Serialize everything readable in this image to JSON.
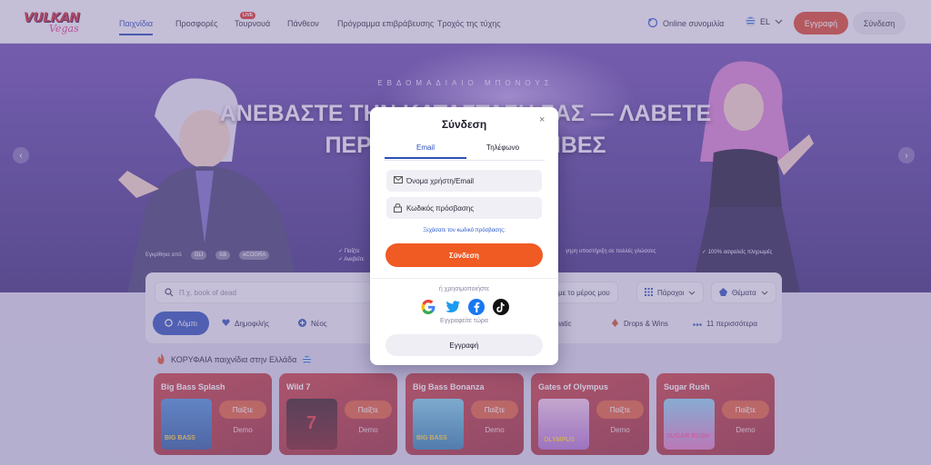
{
  "header": {
    "logo_text_1": "VULKAN",
    "logo_text_2": "Vegas",
    "nav": [
      {
        "label": "Παιχνίδια",
        "active": true
      },
      {
        "label": "Προσφορές"
      },
      {
        "label": "Τουρνουά",
        "badge": "LIVE"
      },
      {
        "label": "Πάνθεον"
      },
      {
        "label": "Πρόγραμμα επιβράβευσης"
      },
      {
        "label": "Τροχός της τύχης"
      }
    ],
    "online_chat": "Online συνομιλία",
    "language": "EL",
    "register_btn": "Εγγραφή",
    "login_btn": "Σύνδεση"
  },
  "hero": {
    "subtitle": "ΕΒΔΟΜΑΔΙΑΙΟ ΜΠΟΝΟΥΣ",
    "title_line1": "ΑΝΕΒΑΣΤΕ ΤΗΝ ΚΑΤΑΣΤΑΣΗ ΣΑΣ — ΛΑΒΕΤΕ",
    "title_line2": "ΠΕΡΙΣΣΟΤΕΡΕΣ ΑΜΟΙΒΕΣ",
    "approved_by": "Εγκρίθηκε από",
    "approved_logos": [
      "GLI",
      "lcb",
      "eCOGRA"
    ],
    "checks": [
      "Παίξτε",
      "Ανεβείτε",
      "γηρη υποστήριξη σε πολλές γλώσσες",
      "100% ασφαλείς πληρωμές"
    ],
    "prev": "‹",
    "next": "›"
  },
  "search": {
    "placeholder": "Π.χ. book of dead",
    "filters": [
      "με το μέρος μου",
      "Πάροχοι",
      "Θέματα"
    ],
    "categories": [
      {
        "label": "Λόμπι",
        "icon": "lobby-icon"
      },
      {
        "label": "Δημοφιλής",
        "icon": "heart-icon"
      },
      {
        "label": "Νέος",
        "icon": "plus-icon"
      },
      {
        "label": "novomatic",
        "icon": "novomatic-icon"
      },
      {
        "label": "Drops & Wins",
        "icon": "drops-icon"
      },
      {
        "label": "11 περισσότερα",
        "icon": "more-icon"
      }
    ]
  },
  "top_games": {
    "label": "ΚΟΡΥΦΑΙΑ παιχνίδια στην Ελλάδα",
    "play_label": "Παίξτε",
    "demo_label": "Demo",
    "games": [
      {
        "name": "Big Bass Splash",
        "thumb_text": "BIG BASS"
      },
      {
        "name": "Wild 7",
        "thumb_text": "7"
      },
      {
        "name": "Big Bass Bonanza",
        "thumb_text": "BIG BASS"
      },
      {
        "name": "Gates of Olympus",
        "thumb_text": "OLYMPUS"
      },
      {
        "name": "Sugar Rush",
        "thumb_text": "SUGAR RUSH"
      }
    ]
  },
  "modal": {
    "title": "Σύνδεση",
    "close": "×",
    "tabs": [
      "Email",
      "Τηλέφωνο"
    ],
    "username_placeholder": "Όνομα χρήστη/Email",
    "password_placeholder": "Κωδικός πρόσβασης",
    "forgot": "Ξεχάσατε τον κωδικό πρόσβασης;",
    "login_button": "Σύνδεση",
    "or_use": "ή χρησιμοποιήστε",
    "socials": [
      "google-icon",
      "twitter-icon",
      "facebook-icon",
      "tiktok-icon"
    ],
    "register_now": "Εγγραφείτε τώρα",
    "register_button": "Εγγραφή"
  },
  "colors": {
    "accent_orange": "#f05a23",
    "brand_blue": "#2c4fb8",
    "register_red": "#d8442a"
  }
}
